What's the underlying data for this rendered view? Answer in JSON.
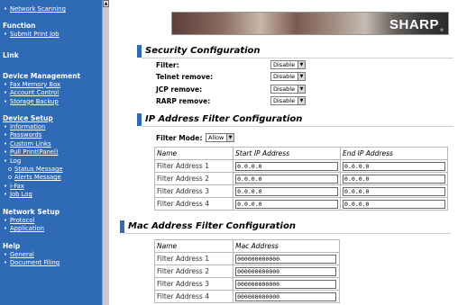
{
  "sidebar": {
    "top_item": "Network Scanning",
    "function_heading": "Function",
    "function_items": [
      "Submit Print Job"
    ],
    "link_heading": "Link",
    "device_mgmt_heading": "Device Management",
    "device_mgmt_items": [
      "Fax Memory Box",
      "Account Control",
      "Storage Backup"
    ],
    "device_setup_heading": "Device Setup",
    "device_setup_items": [
      "Information",
      "Passwords",
      "Custom Links",
      "Pull Print(Panel)",
      "Log"
    ],
    "log_subitems": [
      "Status Message",
      "Alerts Message"
    ],
    "device_setup_items2": [
      "i-Fax",
      "Job Log"
    ],
    "network_heading": "Network Setup",
    "network_items": [
      "Protocol",
      "Application"
    ],
    "help_heading": "Help",
    "help_items": [
      "General",
      "Document Filing"
    ]
  },
  "banner": {
    "logo": "SHARP",
    "reg": "®"
  },
  "security": {
    "title": "Security Configuration",
    "rows": [
      {
        "label": "Filter:",
        "value": "Disable"
      },
      {
        "label": "Telnet remove:",
        "value": "Disable"
      },
      {
        "label": "JCP remove:",
        "value": "Disable"
      },
      {
        "label": "RARP remove:",
        "value": "Disable"
      }
    ]
  },
  "ip_filter": {
    "title": "IP Address Filter Configuration",
    "mode_label": "Filter Mode:",
    "mode_value": "Allow",
    "headers": [
      "Name",
      "Start IP Address",
      "End IP Address"
    ],
    "rows": [
      {
        "name": "Filter Address 1",
        "start": "0.0.0.0",
        "end": "0.0.0.0"
      },
      {
        "name": "Filter Address 2",
        "start": "0.0.0.0",
        "end": "0.0.0.0"
      },
      {
        "name": "Filter Address 3",
        "start": "0.0.0.0",
        "end": "0.0.0.0"
      },
      {
        "name": "Filter Address 4",
        "start": "0.0.0.0",
        "end": "0.0.0.0"
      }
    ]
  },
  "mac_filter": {
    "title": "Mac Address Filter Configuration",
    "headers": [
      "Name",
      "Mac Address"
    ],
    "rows": [
      {
        "name": "Filter Address 1",
        "mac": "000000000000"
      },
      {
        "name": "Filter Address 2",
        "mac": "000000000000"
      },
      {
        "name": "Filter Address 3",
        "mac": "000000000000"
      },
      {
        "name": "Filter Address 4",
        "mac": "000000000000"
      }
    ]
  },
  "colors": {
    "sidebar": "#2f6ab7",
    "accent": "#2f6ab7"
  }
}
